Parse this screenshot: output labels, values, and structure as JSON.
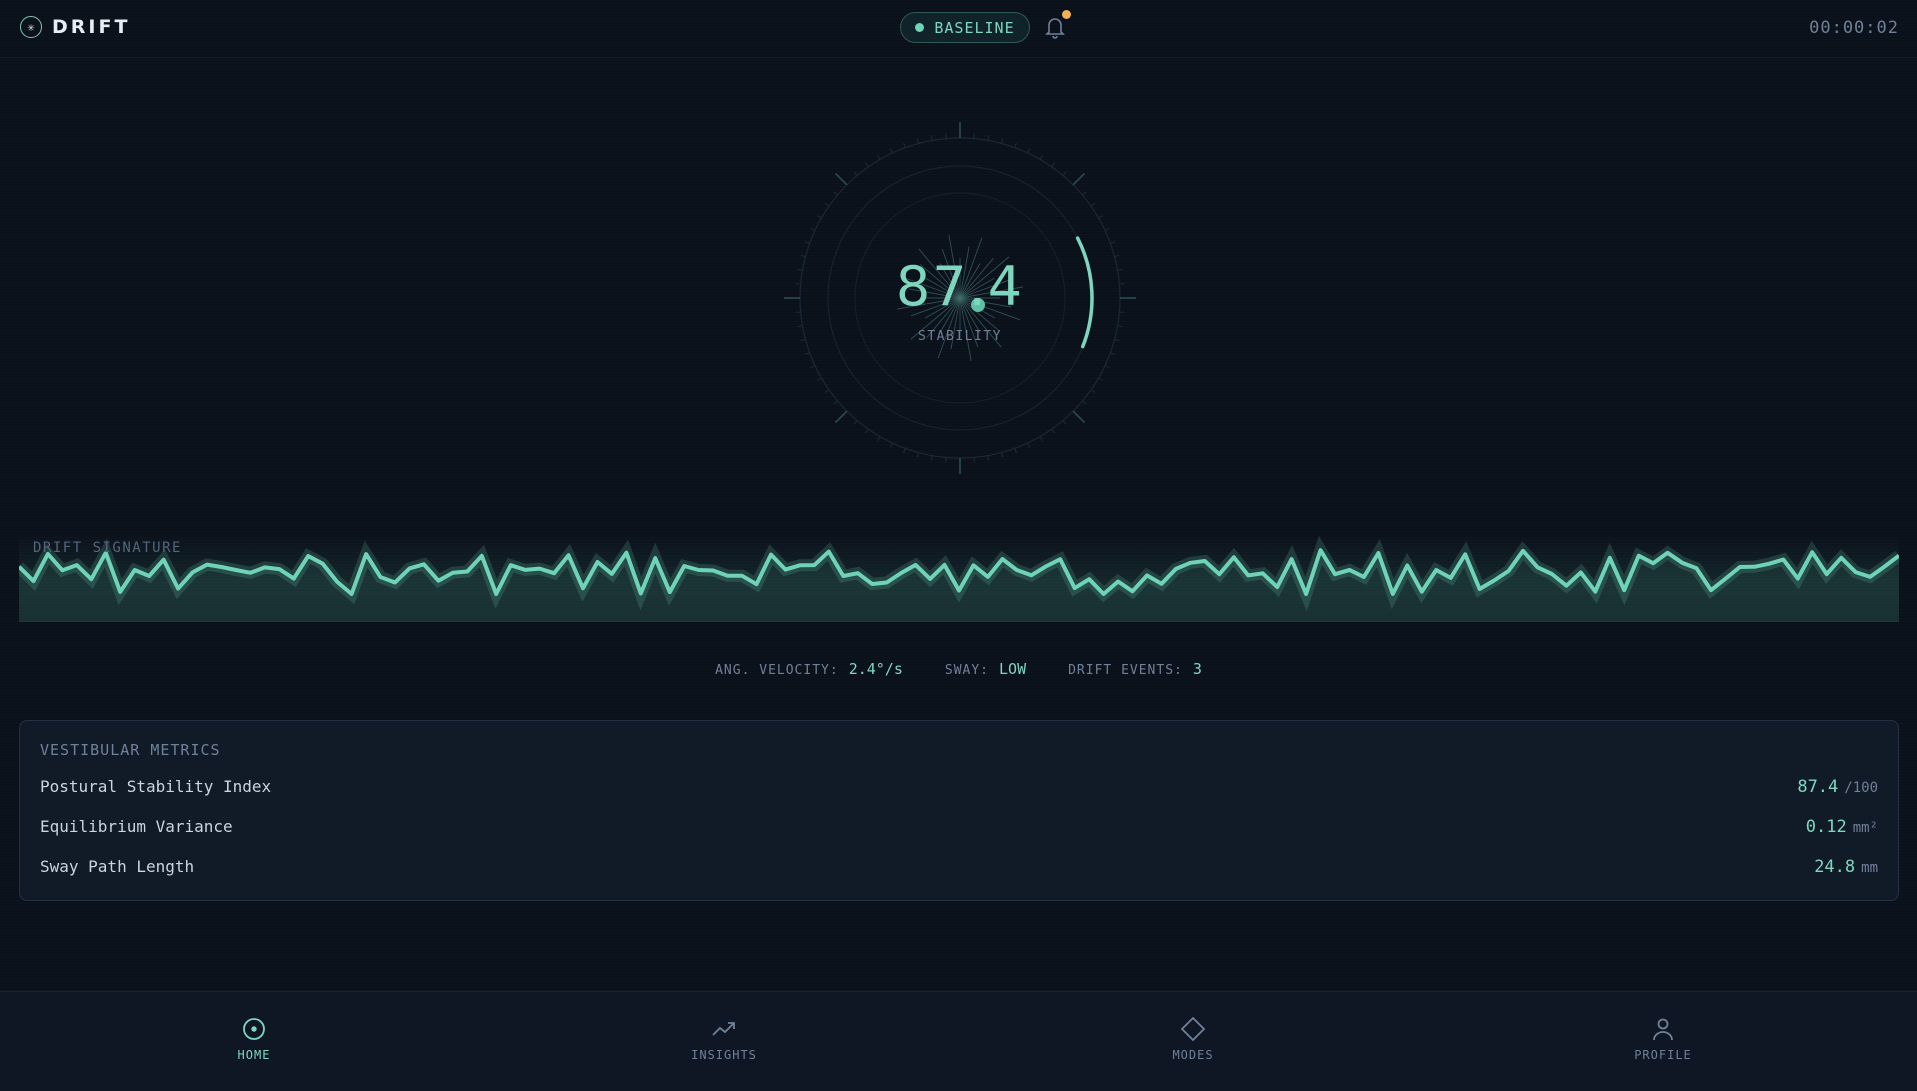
{
  "app": {
    "brand": "DRIFT",
    "timer": "00:00:02"
  },
  "header": {
    "mode_label": "BASELINE",
    "notification_badge": true
  },
  "gauge": {
    "value": "87.4",
    "label": "STABILITY",
    "fraction": 0.874
  },
  "signature": {
    "label": "DRIFT SIGNATURE",
    "color": "#6fd3b8"
  },
  "readouts": [
    {
      "key": "ANG. VELOCITY:",
      "value": "2.4°/s"
    },
    {
      "key": "SWAY:",
      "value": "LOW"
    },
    {
      "key": "DRIFT EVENTS:",
      "value": "3"
    }
  ],
  "metrics": {
    "title": "VESTIBULAR METRICS",
    "rows": [
      {
        "name": "Postural Stability Index",
        "value": "87.4",
        "unit": "/100"
      },
      {
        "name": "Equilibrium Variance",
        "value": "0.12",
        "unit": "mm²"
      },
      {
        "name": "Sway Path Length",
        "value": "24.8",
        "unit": "mm"
      }
    ]
  },
  "nav": [
    {
      "label": "HOME",
      "icon": "target-icon",
      "active": true
    },
    {
      "label": "INSIGHTS",
      "icon": "trend-up-icon",
      "active": false
    },
    {
      "label": "MODES",
      "icon": "diamond-icon",
      "active": false
    },
    {
      "label": "PROFILE",
      "icon": "user-icon",
      "active": false
    }
  ],
  "colors": {
    "accent": "#7fd6bf",
    "background": "#0b111b",
    "badge": "#f2b05a"
  }
}
